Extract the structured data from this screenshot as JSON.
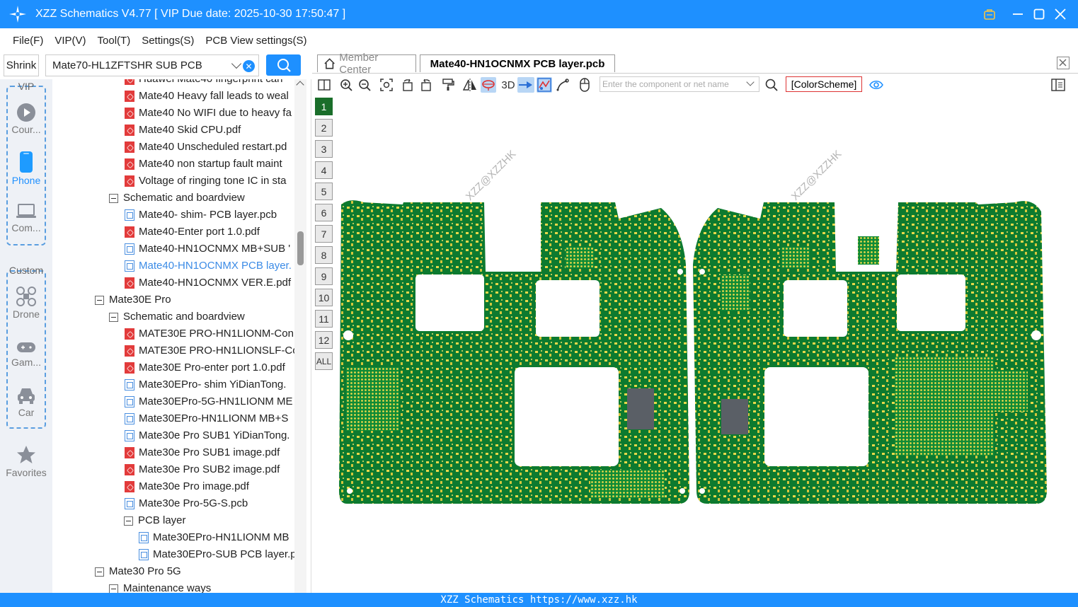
{
  "window": {
    "title": "XZZ Schematics V4.77 [ VIP Due date: 2025-10-30 17:50:47 ]",
    "controls": [
      "vip-icon",
      "minimize-icon",
      "maximize-icon",
      "close-icon"
    ]
  },
  "menu": [
    "File(F)",
    "VIP(V)",
    "Tool(T)",
    "Settings(S)",
    "PCB View settings(S)"
  ],
  "search": {
    "shrink_label": "Shrink",
    "combo_value": "Mate70-HL1ZFTSHR SUB PCB"
  },
  "rail": {
    "vip_title": "VIP",
    "custom_title": "Custom",
    "items": [
      {
        "label": "Cour...",
        "icon": "play-icon"
      },
      {
        "label": "Phone",
        "icon": "phone-icon"
      },
      {
        "label": "Com...",
        "icon": "laptop-icon"
      },
      {
        "label": "Drone",
        "icon": "drone-icon"
      },
      {
        "label": "Gam...",
        "icon": "gamepad-icon"
      },
      {
        "label": "Car",
        "icon": "car-icon"
      },
      {
        "label": "Favorites",
        "icon": "star-icon"
      }
    ]
  },
  "tree": [
    {
      "label": "Huawei Mate40 fingerprint can",
      "type": "pdf",
      "level": 3
    },
    {
      "label": "Mate40 Heavy fall leads to weal",
      "type": "pdf",
      "level": 3
    },
    {
      "label": "Mate40 No WIFI due to heavy fa",
      "type": "pdf",
      "level": 3
    },
    {
      "label": "Mate40 Skid CPU.pdf",
      "type": "pdf",
      "level": 3
    },
    {
      "label": "Mate40 Unscheduled restart.pd",
      "type": "pdf",
      "level": 3
    },
    {
      "label": "Mate40 non startup fault maint",
      "type": "pdf",
      "level": 3
    },
    {
      "label": "Voltage of ringing tone IC in sta",
      "type": "pdf",
      "level": 3
    },
    {
      "label": "Schematic and boardview",
      "type": "folder",
      "level": 2
    },
    {
      "label": "Mate40- shim- PCB layer.pcb",
      "type": "pcb",
      "level": 3
    },
    {
      "label": "Mate40-Enter port 1.0.pdf",
      "type": "pdf",
      "level": 3
    },
    {
      "label": "Mate40-HN1OCNMX MB+SUB '",
      "type": "pcb",
      "level": 3
    },
    {
      "label": "Mate40-HN1OCNMX PCB layer.",
      "type": "pcb",
      "level": 3,
      "selected": true
    },
    {
      "label": "Mate40-HN1OCNMX VER.E.pdf",
      "type": "pdf",
      "level": 3
    },
    {
      "label": "Mate30E Pro",
      "type": "folder",
      "level": 1
    },
    {
      "label": "Schematic and boardview",
      "type": "folder",
      "level": 2
    },
    {
      "label": "MATE30E PRO-HN1LIONM-Con",
      "type": "pdf",
      "level": 3
    },
    {
      "label": "MATE30E PRO-HN1LIONSLF-Co",
      "type": "pdf",
      "level": 3
    },
    {
      "label": "Mate30E Pro-enter port 1.0.pdf",
      "type": "pdf",
      "level": 3
    },
    {
      "label": "Mate30EPro- shim YiDianTong.",
      "type": "pcb",
      "level": 3
    },
    {
      "label": "Mate30EPro-5G-HN1LIONM ME",
      "type": "pcb",
      "level": 3
    },
    {
      "label": "Mate30EPro-HN1LIONM MB+S",
      "type": "pcb",
      "level": 3
    },
    {
      "label": "Mate30e Pro SUB1 YiDianTong.",
      "type": "pcb",
      "level": 3
    },
    {
      "label": "Mate30e Pro SUB1 image.pdf",
      "type": "pdf",
      "level": 3
    },
    {
      "label": "Mate30e Pro SUB2 image.pdf",
      "type": "pdf",
      "level": 3
    },
    {
      "label": "Mate30e Pro image.pdf",
      "type": "pdf",
      "level": 3
    },
    {
      "label": "Mate30e Pro-5G-S.pcb",
      "type": "pcb",
      "level": 3
    },
    {
      "label": "PCB layer",
      "type": "folder",
      "level": 3
    },
    {
      "label": "Mate30EPro-HN1LIONM MB",
      "type": "pcb",
      "level": 4
    },
    {
      "label": "Mate30EPro-SUB PCB layer.p",
      "type": "pcb",
      "level": 4
    },
    {
      "label": "Mate30 Pro 5G",
      "type": "folder",
      "level": 1
    },
    {
      "label": "Maintenance ways",
      "type": "folder",
      "level": 2
    }
  ],
  "tabs": {
    "member": "Member Center",
    "active": "Mate40-HN1OCNMX PCB layer.pcb"
  },
  "toolbar": {
    "net_placeholder": "Enter the component or net name",
    "color_scheme": "[ColorScheme]",
    "three_d": "3D"
  },
  "layers": [
    "1",
    "2",
    "3",
    "4",
    "5",
    "6",
    "7",
    "8",
    "9",
    "10",
    "11",
    "12",
    "ALL"
  ],
  "active_layer": "1",
  "pcb": {
    "watermark": "XZZ@XZZHK",
    "colors": {
      "board": "#0d7a2f",
      "pad": "#e8d84a",
      "hole": "#ffffff"
    }
  },
  "status": "XZZ Schematics https://www.xzz.hk"
}
